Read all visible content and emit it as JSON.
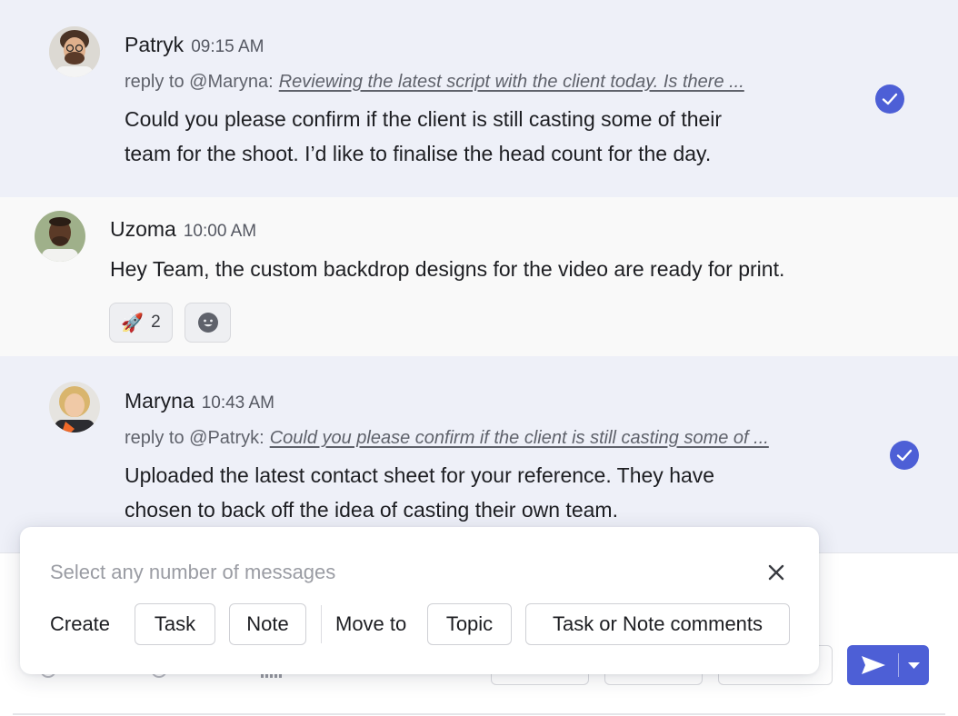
{
  "messages": [
    {
      "author": "Patryk",
      "time": "09:15 AM",
      "reply_prefix": "reply to @Maryna:",
      "reply_quote": "Reviewing the latest script with the client today. Is there ...",
      "body_lines": [
        "Could you please confirm if the client is still casting some of their",
        "team for the shoot. I’d like to finalise the head count for the day."
      ],
      "selected": true
    },
    {
      "author": "Uzoma",
      "time": "10:00 AM",
      "body_lines": [
        "Hey Team, the custom backdrop designs for the video are ready for print."
      ],
      "reactions": [
        {
          "emoji": "🚀",
          "emoji_name": "rocket",
          "count": "2"
        },
        {
          "icon": "add-reaction-icon"
        }
      ],
      "selected": false
    },
    {
      "author": "Maryna",
      "time": "10:43 AM",
      "reply_prefix": "reply to @Patryk:",
      "reply_quote": "Could you please confirm if the client is still casting some of ...",
      "body_lines": [
        "Uploaded the latest contact sheet for your reference. They have",
        "chosen to back off the idea of casting their own team."
      ],
      "selected": true
    }
  ],
  "selection_bar": {
    "hint": "Select any number of messages",
    "create_label": "Create",
    "task_label": "Task",
    "note_label": "Note",
    "move_to_label": "Move to",
    "topic_label": "Topic",
    "task_note_comments_label": "Task or Note comments"
  },
  "colors": {
    "accent": "#4d5fd6",
    "selected_bg": "#eef0f8",
    "plain_bg": "#f9f9f9"
  }
}
